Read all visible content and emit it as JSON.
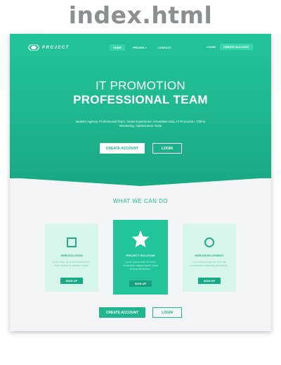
{
  "file_title": "index.html",
  "nav": {
    "logo_text": "PROJECT",
    "links": [
      {
        "label": "HOME",
        "active": true
      },
      {
        "label": "PRICING ▾",
        "active": false
      },
      {
        "label": "CONTACT",
        "active": false
      }
    ],
    "login": "LOGIN",
    "create_account": "CREATE ACCOUNT"
  },
  "hero": {
    "title_line1": "IT PROMOTION",
    "title_line2": "PROFESSIONAL TEAM",
    "description": "Modern Agency, Professional Team, Great Experience, Innovative Idea, IT Promotion, Online Monitoring, Optimization Tools",
    "create_button": "CREATE ACCOUNT",
    "login_button": "LOGIN"
  },
  "services": {
    "title": "WHAT WE CAN DO",
    "cards": [
      {
        "icon": "square-icon",
        "title": "WEB SOLUTION",
        "description": "Lit elit dolor sit amet et elementum, nunc tempus fermentum mattis.",
        "button": "SIGN UP",
        "featured": false
      },
      {
        "icon": "star-icon",
        "title": "PROJECT SOLUTION",
        "description": "Lorem ipsum dolor sit amet, consectetur adipiscing elit. Nunc tempus fermentum.",
        "button": "SIGN UP",
        "featured": true
      },
      {
        "icon": "circle-icon",
        "title": "WEB DEVELOPMENT",
        "description": "Lorem ipsum dolor sit amet elit, consectetur adipiscing elit tempus.",
        "button": "SIGN UP",
        "featured": false
      }
    ]
  },
  "bottom": {
    "create_button": "CREATE ACCOUNT",
    "login_button": "LOGIN"
  },
  "colors": {
    "accent": "#1fb68e",
    "accent_light": "#22c49a",
    "card_bg": "#d6f6ec",
    "title_gray": "#8a8f92"
  }
}
